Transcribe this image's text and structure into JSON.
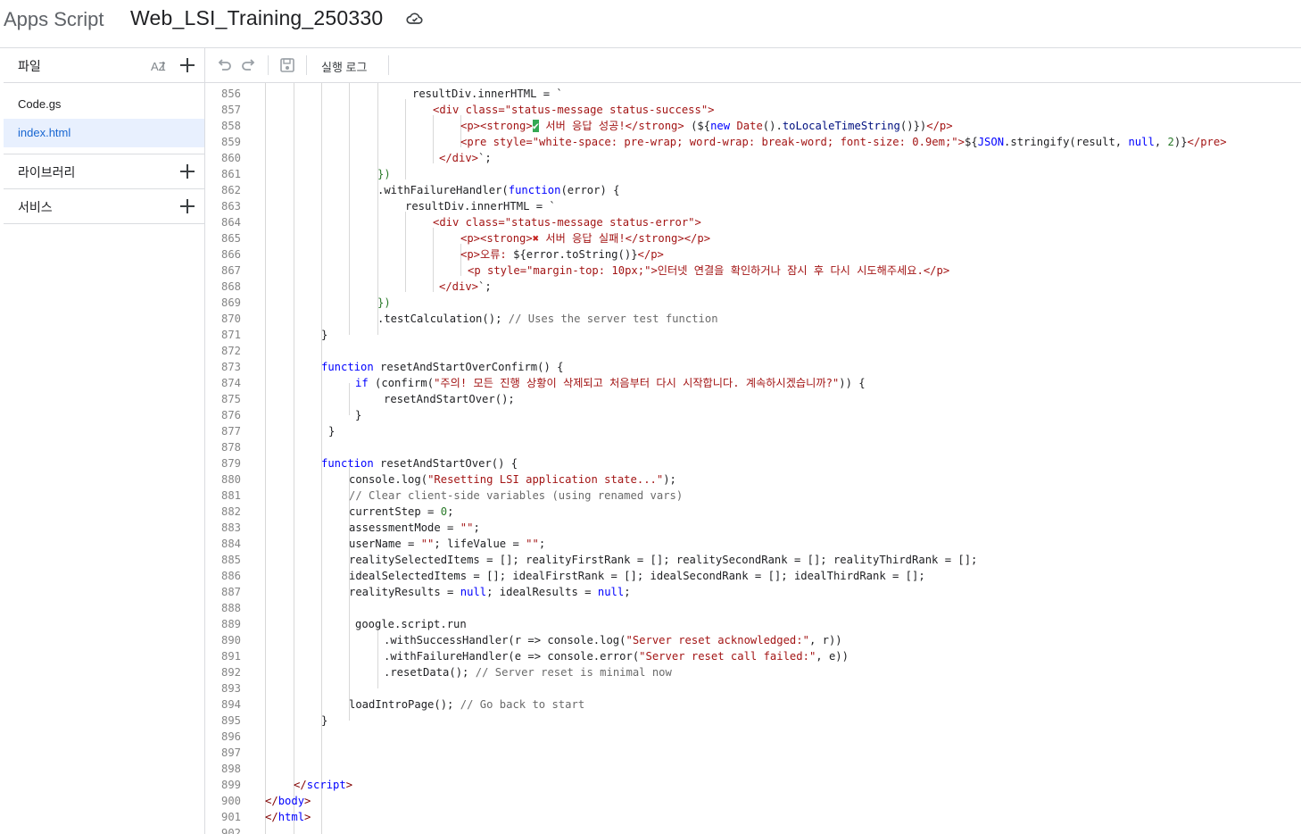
{
  "app": {
    "name": "Apps Script",
    "project_title": "Web_LSI_Training_250330",
    "cloud_icon": "cloud-sync-icon"
  },
  "sidebar": {
    "files_label": "파일",
    "files": [
      {
        "name": "Code.gs",
        "active": false
      },
      {
        "name": "index.html",
        "active": true
      }
    ],
    "libraries_label": "라이브러리",
    "services_label": "서비스"
  },
  "toolbar": {
    "execution_log_label": "실행 로그"
  },
  "editor": {
    "lines": [
      {
        "n": "856",
        "indent": 232,
        "html": "resultDiv.innerHTML = `"
      },
      {
        "n": "857",
        "indent": 255,
        "html": "<span class=\"s\">&lt;div class=\"status-message status-success\"&gt;</span>"
      },
      {
        "n": "858",
        "indent": 286,
        "html": "<span class=\"s\">&lt;p&gt;&lt;strong&gt;</span><span style=\"background:#34a853;color:#fff\">✔</span><span class=\"s\"> 서버 응답 성공!&lt;/strong&gt; </span>(${<span class=\"k\">new</span> <span class=\"s\">Date</span>().<span class=\"f\">toLocaleTimeString</span>()})<span class=\"s\">&lt;/p&gt;</span>"
      },
      {
        "n": "859",
        "indent": 286,
        "html": "<span class=\"s\">&lt;pre style=\"white-space: pre-wrap; word-wrap: break-word; font-size: 0.9em;\"&gt;</span>${<span class=\"k\">JSON</span>.stringify(result, <span class=\"k\">null</span>, <span class=\"b\">2</span>)}<span class=\"s\">&lt;/pre&gt;</span>"
      },
      {
        "n": "860",
        "indent": 262,
        "html": "<span class=\"s\">&lt;/div&gt;</span>`;"
      },
      {
        "n": "861",
        "indent": 193,
        "html": "<span class=\"b\">})</span>"
      },
      {
        "n": "862",
        "indent": 193,
        "html": ".withFailureHandler(<span class=\"k\">function</span>(error) {"
      },
      {
        "n": "863",
        "indent": 224,
        "html": "resultDiv.innerHTML = `"
      },
      {
        "n": "864",
        "indent": 255,
        "html": "<span class=\"s\">&lt;div class=\"status-message status-error\"&gt;</span>"
      },
      {
        "n": "865",
        "indent": 286,
        "html": "<span class=\"s\">&lt;p&gt;&lt;strong&gt;</span><span style=\"color:#c5221f;font-weight:bold\">✖</span><span class=\"s\"> 서버 응답 실패!&lt;/strong&gt;&lt;/p&gt;</span>"
      },
      {
        "n": "866",
        "indent": 286,
        "html": "<span class=\"s\">&lt;p&gt;오류: </span>${error.toString()}<span class=\"s\">&lt;/p&gt;</span>"
      },
      {
        "n": "867",
        "indent": 294,
        "html": "<span class=\"s\">&lt;p style=\"margin-top: 10px;\"&gt;인터넷 연결을 확인하거나 잠시 후 다시 시도해주세요.&lt;/p&gt;</span>"
      },
      {
        "n": "868",
        "indent": 262,
        "html": "<span class=\"s\">&lt;/div&gt;</span>`;"
      },
      {
        "n": "869",
        "indent": 193,
        "html": "<span class=\"b\">})</span>"
      },
      {
        "n": "870",
        "indent": 193,
        "html": ".testCalculation(); <span class=\"c\">// Uses the server test function</span>"
      },
      {
        "n": "871",
        "indent": 130,
        "html": "}"
      },
      {
        "n": "872",
        "indent": 130,
        "html": ""
      },
      {
        "n": "873",
        "indent": 130,
        "html": "<span class=\"k\">function</span> resetAndStartOverConfirm() {"
      },
      {
        "n": "874",
        "indent": 168,
        "html": "<span class=\"k\">if</span> (confirm(<span class=\"s\">\"주의! 모든 진행 상황이 삭제되고 처음부터 다시 시작합니다. 계속하시겠습니까?\"</span>)) {"
      },
      {
        "n": "875",
        "indent": 200,
        "html": "resetAndStartOver();"
      },
      {
        "n": "876",
        "indent": 168,
        "html": "}"
      },
      {
        "n": "877",
        "indent": 138,
        "html": "}"
      },
      {
        "n": "878",
        "indent": 130,
        "html": ""
      },
      {
        "n": "879",
        "indent": 130,
        "html": "<span class=\"k\">function</span> resetAndStartOver() {"
      },
      {
        "n": "880",
        "indent": 161,
        "html": "console.log(<span class=\"s\">\"Resetting LSI application state...\"</span>);"
      },
      {
        "n": "881",
        "indent": 161,
        "html": "<span class=\"c\">// Clear client-side variables (using renamed vars)</span>"
      },
      {
        "n": "882",
        "indent": 161,
        "html": "currentStep = <span class=\"b\">0</span>;"
      },
      {
        "n": "883",
        "indent": 161,
        "html": "assessmentMode = <span class=\"s\">\"\"</span>;"
      },
      {
        "n": "884",
        "indent": 161,
        "html": "userName = <span class=\"s\">\"\"</span>; lifeValue = <span class=\"s\">\"\"</span>;"
      },
      {
        "n": "885",
        "indent": 161,
        "html": "realitySelectedItems = []; realityFirstRank = []; realitySecondRank = []; realityThirdRank = [];"
      },
      {
        "n": "886",
        "indent": 161,
        "html": "idealSelectedItems = []; idealFirstRank = []; idealSecondRank = []; idealThirdRank = [];"
      },
      {
        "n": "887",
        "indent": 161,
        "html": "realityResults = <span class=\"k\">null</span>; idealResults = <span class=\"k\">null</span>;"
      },
      {
        "n": "888",
        "indent": 161,
        "html": ""
      },
      {
        "n": "889",
        "indent": 168,
        "html": "google.script.run"
      },
      {
        "n": "890",
        "indent": 200,
        "html": ".withSuccessHandler(r =&gt; console.log(<span class=\"s\">\"Server reset acknowledged:\"</span>, r))"
      },
      {
        "n": "891",
        "indent": 200,
        "html": ".withFailureHandler(e =&gt; console.error(<span class=\"s\">\"Server reset call failed:\"</span>, e))"
      },
      {
        "n": "892",
        "indent": 200,
        "html": ".resetData(); <span class=\"c\">// Server reset is minimal now</span>"
      },
      {
        "n": "893",
        "indent": 161,
        "html": ""
      },
      {
        "n": "894",
        "indent": 161,
        "html": "loadIntroPage(); <span class=\"c\">// Go back to start</span>"
      },
      {
        "n": "895",
        "indent": 130,
        "html": "}"
      },
      {
        "n": "896",
        "indent": 130,
        "html": ""
      },
      {
        "n": "897",
        "indent": 130,
        "html": ""
      },
      {
        "n": "898",
        "indent": 130,
        "html": ""
      },
      {
        "n": "899",
        "indent": 99,
        "html": "<span class=\"t\">&lt;/</span><span class=\"k\">script</span><span class=\"t\">&gt;</span>"
      },
      {
        "n": "900",
        "indent": 67,
        "html": "<span class=\"t\">&lt;/</span><span class=\"k\">body</span><span class=\"t\">&gt;</span>"
      },
      {
        "n": "901",
        "indent": 67,
        "html": "<span class=\"t\">&lt;/</span><span class=\"k\">html</span><span class=\"t\">&gt;</span>"
      },
      {
        "n": "902",
        "indent": 67,
        "html": ""
      }
    ]
  }
}
